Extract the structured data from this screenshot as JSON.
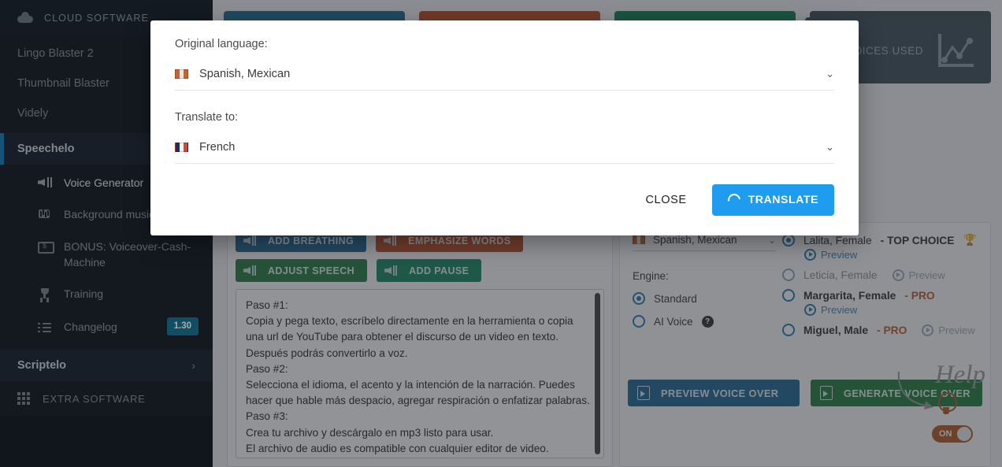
{
  "sidebar": {
    "brand": "CLOUD SOFTWARE",
    "brand_icon": "cloud-icon",
    "items": [
      {
        "label": "Lingo Blaster 2"
      },
      {
        "label": "Thumbnail Blaster"
      },
      {
        "label": "Videly"
      }
    ],
    "active_section": "Speechelo",
    "sub_items": [
      {
        "label": "Voice Generator",
        "icon": "megaphone-icon"
      },
      {
        "label": "Background music",
        "icon": "music-icon"
      },
      {
        "label": "BONUS: Voiceover-Cash-Machine",
        "icon": "cash-icon"
      },
      {
        "label": "Training",
        "icon": "trophy-icon"
      },
      {
        "label": "Changelog",
        "icon": "list-icon",
        "badge": "1.30"
      }
    ],
    "scriptelo": {
      "label": "Scriptelo",
      "chevron": "›"
    },
    "extra": {
      "label": "EXTRA SOFTWARE",
      "icon": "grid-icon"
    }
  },
  "main": {
    "tabs": [
      {
        "label": "",
        "color": "#15658b"
      },
      {
        "label": "",
        "color": "#b8441a"
      },
      {
        "label": "",
        "color": "#0b7a4b"
      },
      {
        "label": "",
        "color": "#38474f"
      }
    ],
    "stat_card": {
      "label": "E VOICES USED",
      "icon": "line-chart-icon"
    },
    "effects": [
      {
        "label": "ADD BREATHING",
        "color": "#1b6391"
      },
      {
        "label": "EMPHASIZE WORDS",
        "color": "#ba4a1f"
      },
      {
        "label": "ADJUST SPEECH",
        "color": "#1f7a3c"
      },
      {
        "label": "ADD PAUSE",
        "color": "#0f8459"
      }
    ],
    "script_text": "Paso #1:\nCopia y pega texto, escríbelo directamente en la herramienta o copia una url de YouTube para obtener el discurso de un video en texto. Después podrás convertirlo a voz.\nPaso #2:\nSelecciona el idioma, el acento y la intención de la narración. Puedes hacer que hable más despacio, agregar respiración o enfatizar palabras.\nPaso #3:\nCrea tu archivo y descárgalo en mp3 listo para usar.\nEl archivo de audio es compatible con cualquier editor de video.",
    "voice_panel": {
      "language_value": "Spanish, Mexican",
      "engine_label": "Engine:",
      "engines": [
        {
          "label": "Standard",
          "selected": true
        },
        {
          "label": "AI Voice",
          "selected": false,
          "help": "?"
        }
      ],
      "preview_label": "Preview",
      "voices": [
        {
          "name": "Lalita, Female",
          "tag": "- TOP CHOICE",
          "trophy": "🏆",
          "selected": true,
          "dimmed": false,
          "preview_below": true
        },
        {
          "name": "Leticia, Female",
          "tag": "",
          "trophy": "",
          "selected": false,
          "dimmed": true,
          "preview_below": false
        },
        {
          "name": "Margarita, Female",
          "tag": "- PRO",
          "trophy": "",
          "selected": false,
          "dimmed": false,
          "preview_below": true
        },
        {
          "name": "Miguel, Male",
          "tag": "- PRO",
          "trophy": "",
          "selected": false,
          "dimmed": false,
          "preview_below": false
        }
      ],
      "cta_preview": "PREVIEW VOICE OVER",
      "cta_generate": "GENERATE VOICE OVER"
    },
    "help_widget": {
      "word": "Help",
      "toggle_state": "ON",
      "icon": "lightbulb-icon"
    }
  },
  "modal": {
    "original_label": "Original language:",
    "original_value": "Spanish, Mexican",
    "original_flag": "flag-mexico",
    "translate_label": "Translate to:",
    "translate_value": "French",
    "translate_flag": "flag-france",
    "close_label": "CLOSE",
    "translate_button_label": "TRANSLATE",
    "translate_icon": "spinner-icon",
    "accent_color": "#1f9bf0",
    "chevron": "⌄"
  }
}
